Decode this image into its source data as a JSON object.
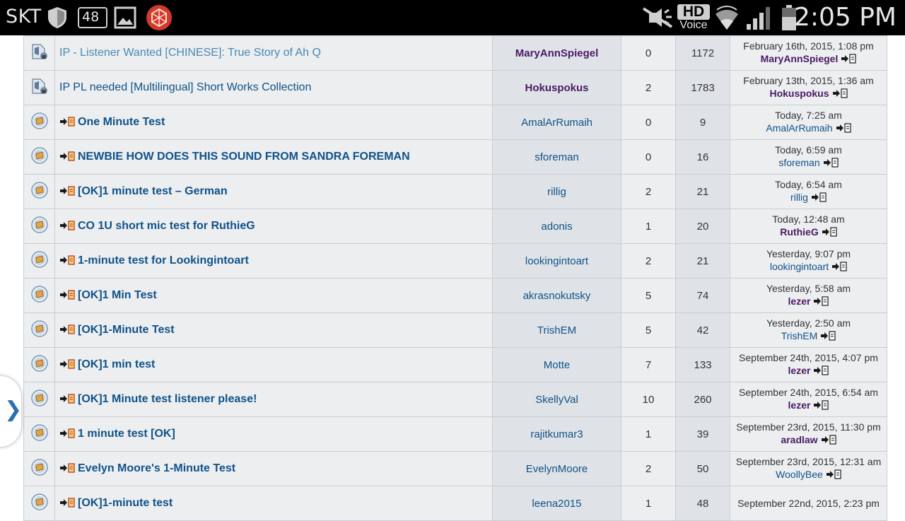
{
  "status_bar": {
    "carrier": "SKT",
    "battery_badge": "48",
    "hd_label": "HD",
    "voice_label": "Voice",
    "time": "2:05 PM"
  },
  "topics": [
    {
      "kind": "announce",
      "title": "IP - Listener Wanted [CHINESE]: True Story of Ah Q",
      "title_style": "sticky",
      "author": "MaryAnnSpiegel",
      "author_bold": true,
      "replies": "0",
      "views": "1172",
      "last_date": "February 16th, 2015, 1:08 pm",
      "last_user": "MaryAnnSpiegel",
      "last_user_bold": true
    },
    {
      "kind": "announce",
      "title": "IP PL needed [Multilingual] Short Works Collection",
      "title_style": "sticky2",
      "author": "Hokuspokus",
      "author_bold": true,
      "replies": "2",
      "views": "1783",
      "last_date": "February 13th, 2015, 1:36 am",
      "last_user": "Hokuspokus",
      "last_user_bold": true
    },
    {
      "kind": "new",
      "title": "One Minute Test",
      "author": "AmalArRumaih",
      "author_bold": false,
      "replies": "0",
      "views": "9",
      "last_date": "Today, 7:25 am",
      "last_user": "AmalArRumaih",
      "last_user_bold": false
    },
    {
      "kind": "new",
      "title": "NEWBIE HOW DOES THIS SOUND FROM SANDRA FOREMAN",
      "author": "sforeman",
      "author_bold": false,
      "replies": "0",
      "views": "16",
      "last_date": "Today, 6:59 am",
      "last_user": "sforeman",
      "last_user_bold": false
    },
    {
      "kind": "new",
      "title": "[OK]1 minute test – German",
      "author": "rillig",
      "author_bold": false,
      "replies": "2",
      "views": "21",
      "last_date": "Today, 6:54 am",
      "last_user": "rillig",
      "last_user_bold": false
    },
    {
      "kind": "new",
      "title": "CO 1U short mic test for RuthieG",
      "author": "adonis",
      "author_bold": false,
      "replies": "1",
      "views": "20",
      "last_date": "Today, 12:48 am",
      "last_user": "RuthieG",
      "last_user_bold": true
    },
    {
      "kind": "new",
      "title": "1-minute test for Lookingintoart",
      "author": "lookingintoart",
      "author_bold": false,
      "replies": "2",
      "views": "21",
      "last_date": "Yesterday, 9:07 pm",
      "last_user": "lookingintoart",
      "last_user_bold": false
    },
    {
      "kind": "new",
      "title": "[OK]1 Min Test",
      "author": "akrasnokutsky",
      "author_bold": false,
      "replies": "5",
      "views": "74",
      "last_date": "Yesterday, 5:58 am",
      "last_user": "lezer",
      "last_user_bold": true
    },
    {
      "kind": "new",
      "title": "[OK]1-Minute Test",
      "author": "TrishEM",
      "author_bold": false,
      "replies": "5",
      "views": "42",
      "last_date": "Yesterday, 2:50 am",
      "last_user": "TrishEM",
      "last_user_bold": false
    },
    {
      "kind": "new",
      "title": "[OK]1 min test",
      "author": "Motte",
      "author_bold": false,
      "replies": "7",
      "views": "133",
      "last_date": "September 24th, 2015, 4:07 pm",
      "last_user": "lezer",
      "last_user_bold": true
    },
    {
      "kind": "new",
      "title": "[OK]1 Minute test listener please!",
      "author": "SkellyVal",
      "author_bold": false,
      "replies": "10",
      "views": "260",
      "last_date": "September 24th, 2015, 6:54 am",
      "last_user": "lezer",
      "last_user_bold": true
    },
    {
      "kind": "new",
      "title": "1 minute test [OK]",
      "author": "rajitkumar3",
      "author_bold": false,
      "replies": "1",
      "views": "39",
      "last_date": "September 23rd, 2015, 11:30 pm",
      "last_user": "aradlaw",
      "last_user_bold": true
    },
    {
      "kind": "new",
      "title": "Evelyn Moore's 1-Minute Test",
      "author": "EvelynMoore",
      "author_bold": false,
      "replies": "2",
      "views": "50",
      "last_date": "September 23rd, 2015, 12:31 am",
      "last_user": "WoollyBee",
      "last_user_bold": false
    },
    {
      "kind": "new",
      "title": "[OK]1-minute test",
      "author": "leena2015",
      "author_bold": false,
      "replies": "1",
      "views": "48",
      "last_date": "September 22nd, 2015, 2:23 pm",
      "last_user": "",
      "last_user_bold": false
    }
  ],
  "icons": {
    "announce": "announcement-locked-icon",
    "new": "topic-folder-icon",
    "newpost": "new-post-arrow-icon",
    "goto": "go-to-last-post-icon"
  },
  "colors": {
    "link": "#105289",
    "row_bg": "#eceef0",
    "alt_col_bg": "#dfe3e7",
    "bold_user": "#4a1a66"
  }
}
